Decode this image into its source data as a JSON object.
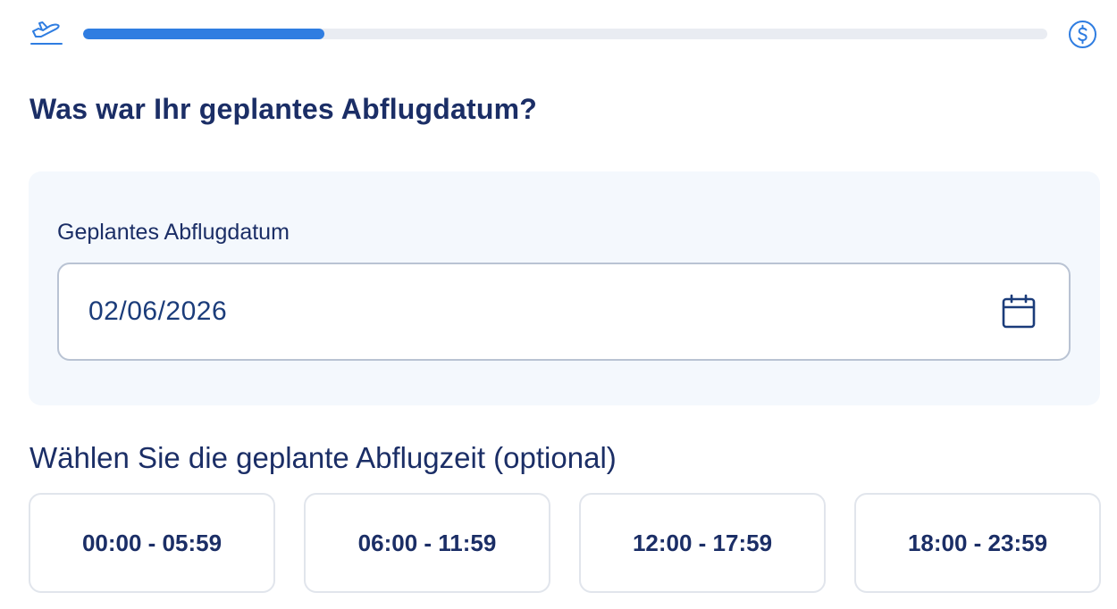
{
  "progress": {
    "value_percent": 25,
    "fill_color": "#2f7de1",
    "track_color": "#e9ecf2",
    "start_icon": "plane-takeoff-icon",
    "end_icon": "dollar-circle-icon"
  },
  "page": {
    "title": "Was war Ihr geplantes Abflugdatum?"
  },
  "date_field": {
    "label": "Geplantes Abflugdatum",
    "value": "02/06/2026",
    "icon": "calendar-icon"
  },
  "time_section": {
    "heading": "Wählen Sie die geplante Abflugzeit (optional)",
    "options": [
      {
        "label": "00:00 - 05:59"
      },
      {
        "label": "06:00 - 11:59"
      },
      {
        "label": "12:00 - 17:59"
      },
      {
        "label": "18:00 - 23:59"
      }
    ]
  },
  "colors": {
    "primary_text": "#1b2e66",
    "accent": "#2f7de1",
    "card_background": "#f4f8fd",
    "input_border": "#b9c3d3"
  }
}
